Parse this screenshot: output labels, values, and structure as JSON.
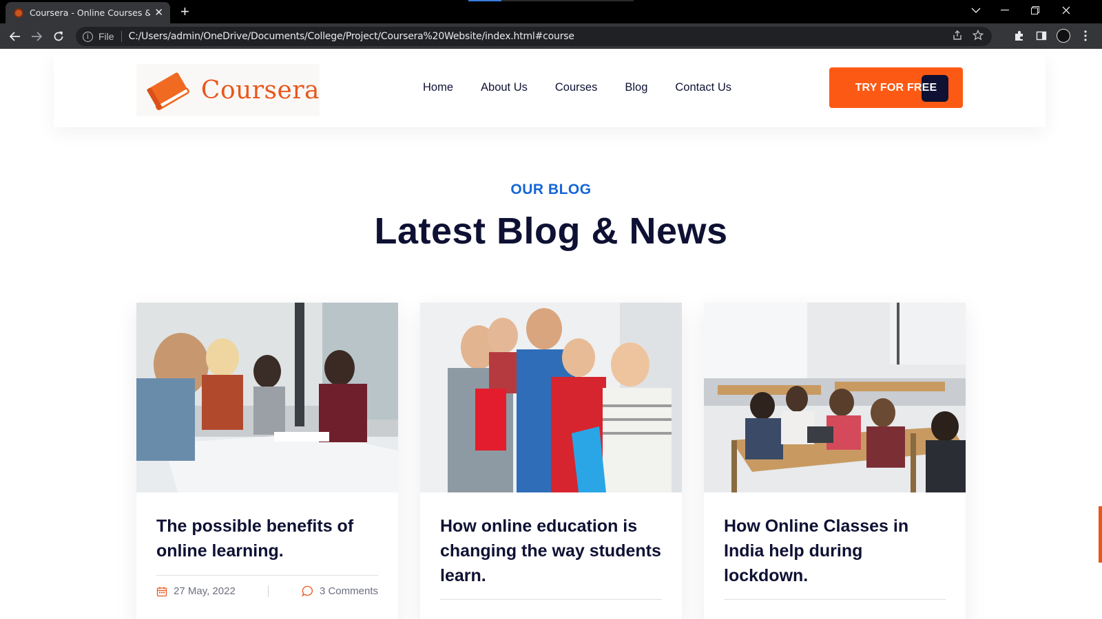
{
  "browser": {
    "tab_title": "Coursera - Online Courses & Edu",
    "scheme_label": "File",
    "url": "C:/Users/admin/OneDrive/Documents/College/Project/Coursera%20Website/index.html#course"
  },
  "site": {
    "brand": "Coursera",
    "brand_color": "#e8571c",
    "nav": [
      "Home",
      "About Us",
      "Courses",
      "Blog",
      "Contact Us"
    ],
    "cta_label": "TRY FOR FREE",
    "cta_color": "#fc5a14"
  },
  "blog": {
    "subtitle": "OUR BLOG",
    "title": "Latest Blog & News",
    "posts": [
      {
        "title": "The possible benefits of online learning.",
        "date": "27 May, 2022",
        "comments": "3 Comments",
        "image": "students-studying-at-table"
      },
      {
        "title": "How online education is changing the way students learn.",
        "image": "happy-students-group"
      },
      {
        "title": "How Online Classes in India help during lockdown.",
        "image": "classroom-with-laptops"
      }
    ]
  }
}
